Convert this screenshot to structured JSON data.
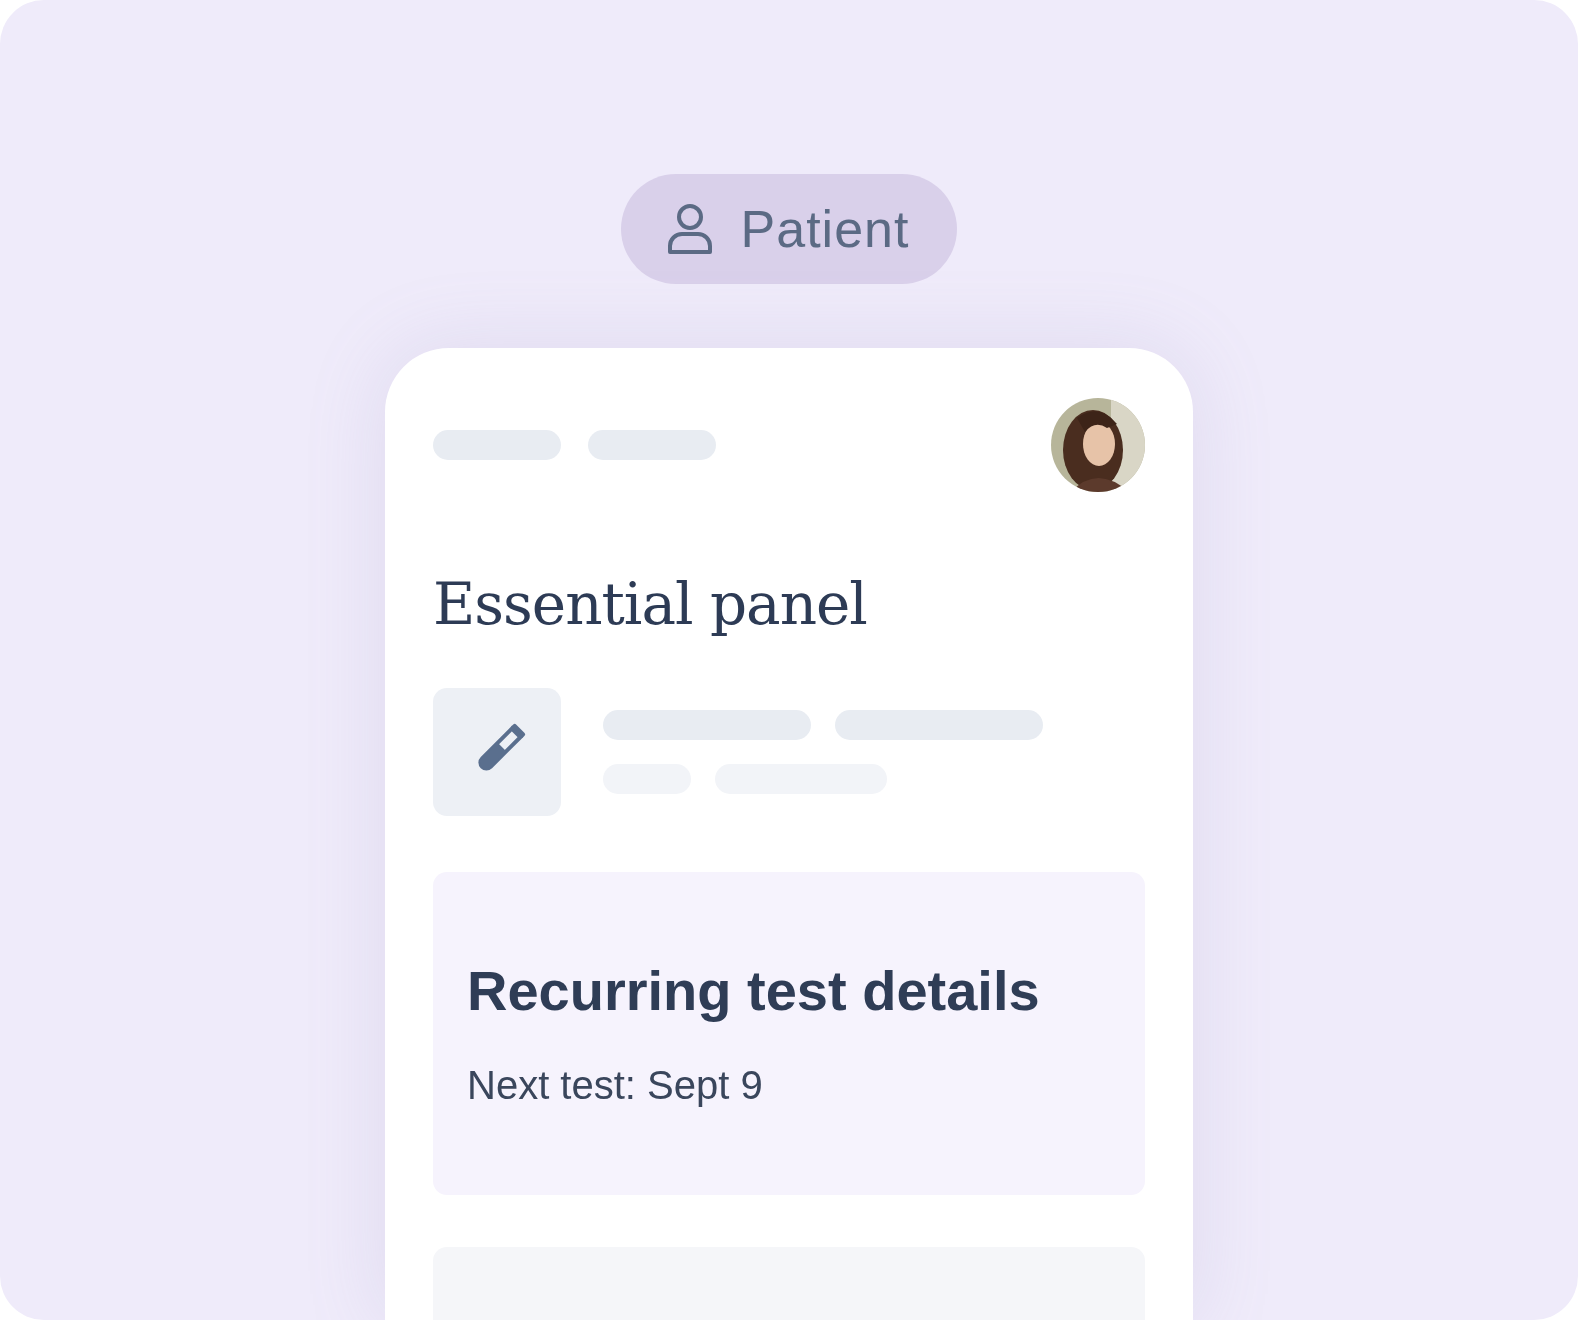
{
  "role_badge": {
    "label": "Patient"
  },
  "screen": {
    "title": "Essential panel",
    "recurring_card": {
      "title": "Recurring test details",
      "next_test": "Next test: Sept 9"
    }
  }
}
